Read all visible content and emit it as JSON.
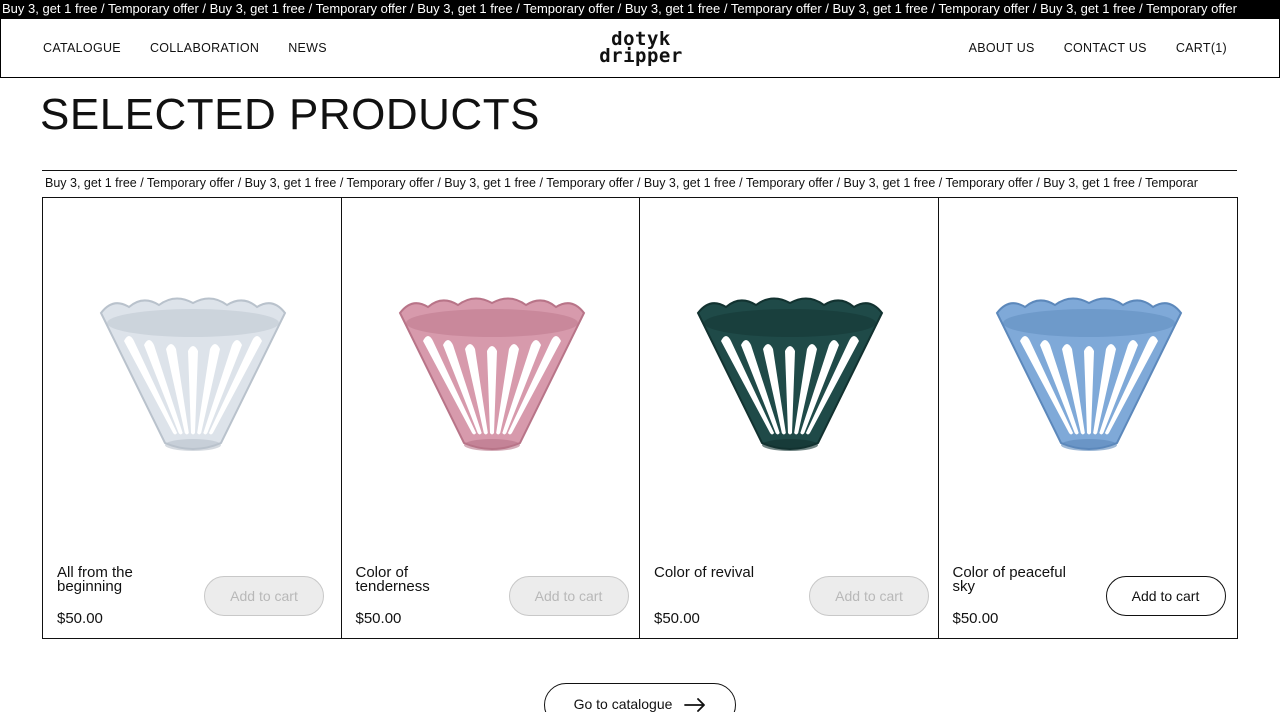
{
  "ticker_top": "Buy 3, get 1 free / Temporary offer / Buy 3, get 1 free / Temporary offer / Buy 3, get 1 free / Temporary offer / Buy 3, get 1 free / Temporary offer / Buy 3, get 1 free / Temporary offer / Buy 3, get 1 free / Temporary offer",
  "nav": {
    "left": [
      "CATALOGUE",
      "COLLABORATION",
      "NEWS"
    ],
    "right": [
      "ABOUT US",
      "CONTACT US",
      "CART(1)"
    ]
  },
  "logo": {
    "line1": "dotyk",
    "line2": "dripper"
  },
  "page_title": "SELECTED PRODUCTS",
  "ticker_mid": "Buy 3, get 1 free / Temporary offer / Buy 3, get 1 free / Temporary offer / Buy 3, get 1 free / Temporary offer / Buy 3, get 1 free / Temporary offer / Buy 3, get 1 free / Temporary offer / Buy 3, get 1 free / Temporar",
  "products": [
    {
      "name": "All from the beginning",
      "price": "$50.00",
      "button": "Add to cart",
      "button_state": "disabled",
      "color": "#dde3ea",
      "shade": "#b9c2cc"
    },
    {
      "name": "Color of tenderness",
      "price": "$50.00",
      "button": "Add to cart",
      "button_state": "disabled",
      "color": "#d79aac",
      "shade": "#b87488"
    },
    {
      "name": "Color of revival",
      "price": "$50.00",
      "button": "Add to cart",
      "button_state": "disabled",
      "color": "#1f4a48",
      "shade": "#123230"
    },
    {
      "name": "Color of peaceful sky",
      "price": "$50.00",
      "button": "Add to cart",
      "button_state": "enabled",
      "color": "#7fa9d8",
      "shade": "#5c88bb"
    }
  ],
  "catalogue_button": "Go to catalogue"
}
